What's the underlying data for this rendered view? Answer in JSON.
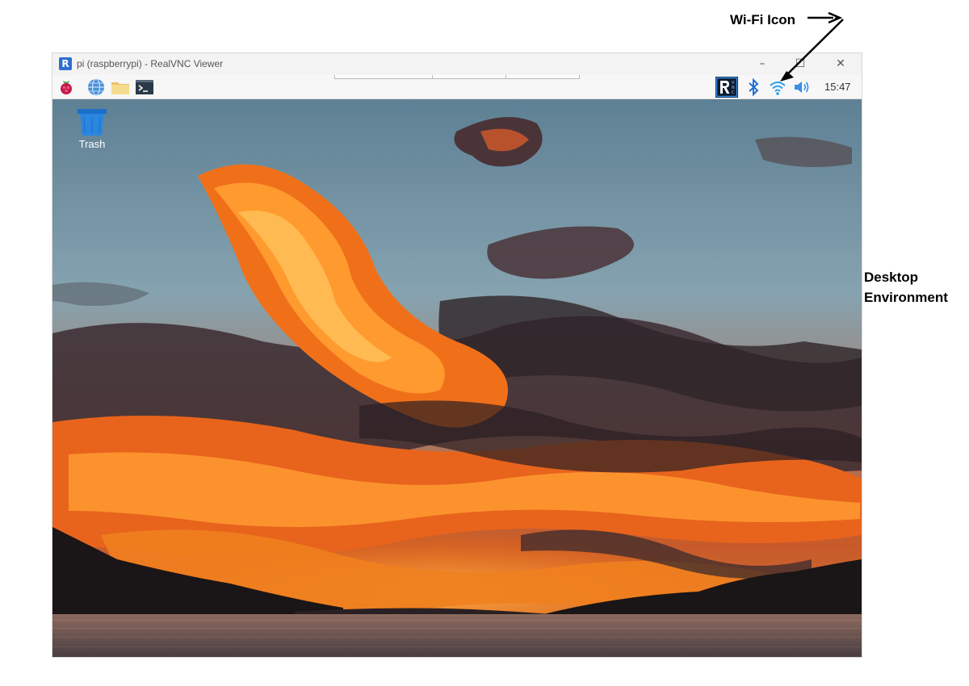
{
  "annotations": {
    "wifi_label": "Wi-Fi Icon",
    "desktop_label_line1": "Desktop",
    "desktop_label_line2": "Environment"
  },
  "window": {
    "title": "pi (raspberrypi) - RealVNC Viewer",
    "logo_glyph": "R",
    "minimize_glyph": "–",
    "maximize_glyph": "☐",
    "close_glyph": "✕"
  },
  "taskbar": {
    "launchers": [
      {
        "name": "raspberry-pi-menu-icon"
      },
      {
        "name": "web-browser-globe-icon"
      },
      {
        "name": "file-manager-folder-icon"
      },
      {
        "name": "terminal-icon"
      }
    ],
    "tray": {
      "icons": [
        "vnc-server-icon",
        "bluetooth-icon",
        "wifi-icon",
        "volume-icon"
      ],
      "clock": "15:47"
    }
  },
  "desktop": {
    "wallpaper": "sunset over lake with fiery orange clouds",
    "icons": [
      {
        "label": "Trash",
        "icon": "trash-icon"
      }
    ]
  },
  "colors": {
    "accent_blue": "#2f6fd1",
    "sky": "#7c9db0",
    "cloud_orange": "#f26a12",
    "cloud_dark": "#3c2a2e"
  }
}
